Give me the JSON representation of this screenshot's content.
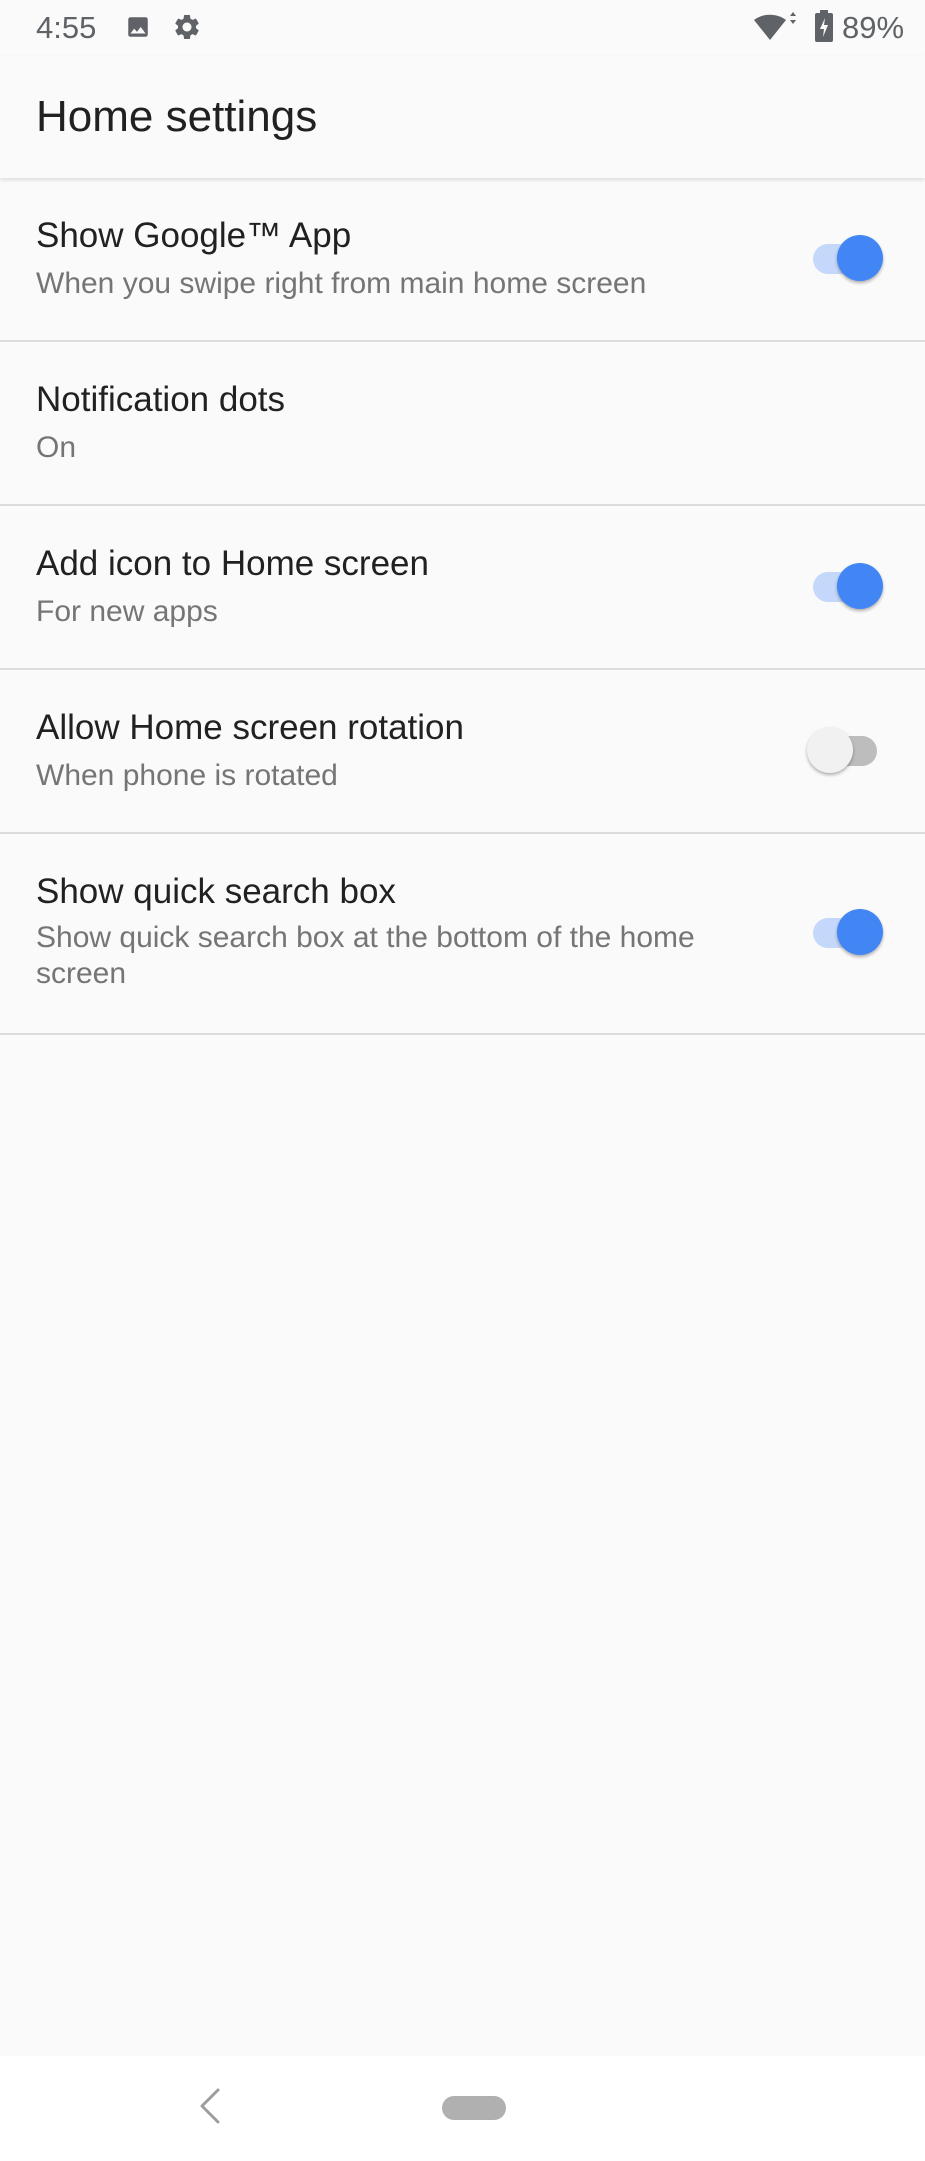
{
  "status_bar": {
    "time": "4:55",
    "battery_percent": "89%",
    "icons": [
      "image-icon",
      "gear-icon",
      "wifi-icon",
      "battery-charging-icon"
    ]
  },
  "app_bar": {
    "title": "Home settings"
  },
  "settings": [
    {
      "title": "Show Google™ App",
      "summary": "When you swipe right from main home screen",
      "has_switch": true,
      "switch_on": true
    },
    {
      "title": "Notification dots",
      "summary": "On",
      "has_switch": false
    },
    {
      "title": "Add icon to Home screen",
      "summary": "For new apps",
      "has_switch": true,
      "switch_on": true
    },
    {
      "title": "Allow Home screen rotation",
      "summary": "When phone is rotated",
      "has_switch": true,
      "switch_on": false
    },
    {
      "title": "Show quick search box",
      "summary": "Show quick search box at the bottom of the home screen",
      "has_switch": true,
      "switch_on": true
    }
  ],
  "colors": {
    "accent": "#4285f4",
    "accent_track": "#c5d8fb",
    "background": "#fafafa",
    "title_text": "#212121",
    "summary_text": "#757575",
    "divider": "#dcdcdc"
  },
  "nav_bar": {
    "icons": [
      "back-icon",
      "home-pill-icon"
    ]
  }
}
